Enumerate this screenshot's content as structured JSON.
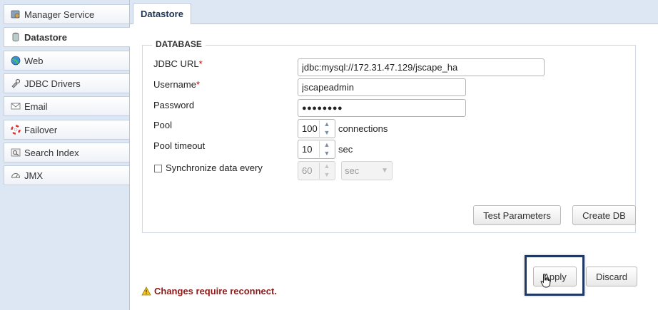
{
  "sidebar": {
    "items": [
      {
        "label": "Manager Service",
        "icon": "service-icon"
      },
      {
        "label": "Datastore",
        "icon": "database-icon",
        "active": true
      },
      {
        "label": "Web",
        "icon": "globe-icon"
      },
      {
        "label": "JDBC Drivers",
        "icon": "driver-icon"
      },
      {
        "label": "Email",
        "icon": "envelope-icon"
      },
      {
        "label": "Failover",
        "icon": "lifebuoy-icon"
      },
      {
        "label": "Search Index",
        "icon": "search-index-icon"
      },
      {
        "label": "JMX",
        "icon": "gauge-icon"
      }
    ]
  },
  "tab": {
    "label": "Datastore"
  },
  "database": {
    "legend": "DATABASE",
    "jdbc_url_label": "JDBC URL",
    "jdbc_url_value": "jdbc:mysql://172.31.47.129/jscape_ha",
    "username_label": "Username",
    "username_value": "jscapeadmin",
    "password_label": "Password",
    "password_value": "●●●●●●●●",
    "pool_label": "Pool",
    "pool_value": "100",
    "pool_unit": "connections",
    "pool_timeout_label": "Pool timeout",
    "pool_timeout_value": "10",
    "pool_timeout_unit": "sec",
    "sync_label": "Synchronize data every",
    "sync_value": "60",
    "sync_unit": "sec",
    "required_mark": "*"
  },
  "buttons": {
    "test_parameters": "Test Parameters",
    "create_db": "Create DB",
    "apply": "Apply",
    "discard": "Discard"
  },
  "warning": {
    "text": "Changes require reconnect.",
    "icon": "warning-icon"
  },
  "colors": {
    "sidebar_bg": "#dde6f3",
    "warning_text": "#8b1a1a",
    "highlight": "#1f3864"
  }
}
